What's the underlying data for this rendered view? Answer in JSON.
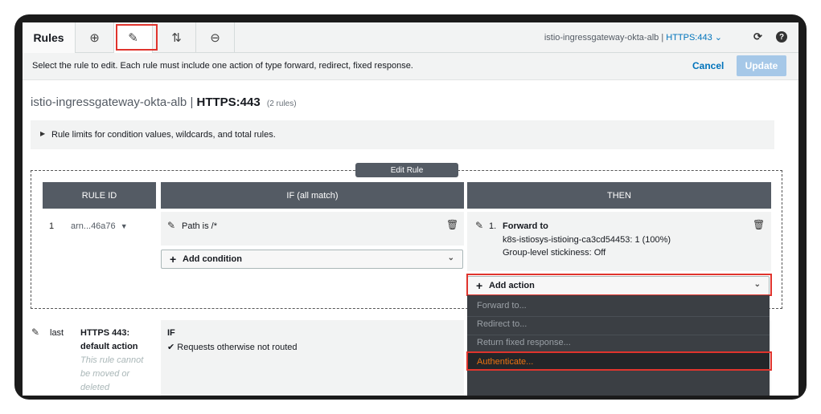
{
  "toolbar": {
    "title": "Rules",
    "add_icon": "⊕",
    "edit_icon": "✎",
    "reorder_icon": "⇅",
    "delete_icon": "⊖",
    "listener_name": "istio-ingressgateway-okta-alb",
    "separator": "|",
    "listener_protocol": "HTTPS:443",
    "listener_chevron": "⌄",
    "refresh_icon": "⟳",
    "help_icon": "?"
  },
  "infobar": {
    "message": "Select the rule to edit. Each rule must include one action of type forward, redirect, fixed response.",
    "cancel_label": "Cancel",
    "update_label": "Update"
  },
  "heading": {
    "lb_name": "istio-ingressgateway-okta-alb",
    "separator": "|",
    "listener": "HTTPS:443",
    "rule_count": "(2 rules)"
  },
  "limits": {
    "caret": "▶",
    "text": "Rule limits for condition values, wildcards, and total rules."
  },
  "edit_rule": {
    "label": "Edit Rule",
    "columns": {
      "rule_id": "RULE ID",
      "if": "IF (all match)",
      "then": "THEN"
    },
    "rule": {
      "number": "1",
      "arn": "arn...46a76",
      "arn_caret": "▼",
      "condition": "Path is /*",
      "add_condition": "Add condition",
      "action_number": "1.",
      "action_title": "Forward to",
      "action_target": "k8s-istiosys-istioing-ca3cd54453: 1 (100%)",
      "action_stickiness": "Group-level stickiness: Off",
      "add_action": "Add action"
    }
  },
  "menu": {
    "items": [
      "Forward to...",
      "Redirect to...",
      "Return fixed response...",
      "Authenticate..."
    ]
  },
  "default_rule": {
    "position": "last",
    "title_line1": "HTTPS 443:",
    "title_line2": "default action",
    "note_line1": "This rule cannot",
    "note_line2": "be moved or",
    "note_line3": "deleted",
    "if_label": "IF",
    "condition": "Requests otherwise not routed"
  },
  "colors": {
    "accent": "#0073bb",
    "highlight": "#e0342d",
    "authenticate": "#ec7211",
    "header_bg": "#545b64"
  }
}
